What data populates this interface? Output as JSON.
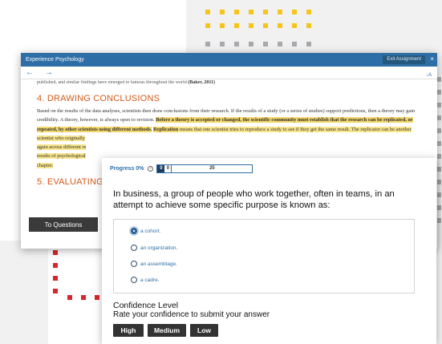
{
  "window": {
    "title": "Experience Psychology",
    "exit_label": "Exit Assignment",
    "close_glyph": "×",
    "back_glyph": "←",
    "forward_glyph": "→",
    "a11y_label": "↓A"
  },
  "reading": {
    "cut_line_start": "published, and similar findings have emerged to famous throughout the world ",
    "cut_line_cite": "(Baker, 2011)",
    "section4_title": "4. DRAWING CONCLUSIONS",
    "p1": "Based on the results of the data analyses, scientists then draw conclusions from their research. If the results of a study (or a series of studies) support predictions, then a theory may gain credibility. A theory, however, is always open to revision. ",
    "p1_hl_bold": "Before a theory is accepted or changed, the scientific community must establish that the research can be replicated, or repeated, by other scientists using different methods.",
    "p1_hl_term": "Replication",
    "p1_hl_rest": " means that one scientist tries to reproduce a study to see if they get the same result. The replicator can be another scientist who originally",
    "p2a": "again across different re",
    "p2b": "results of psychological",
    "p2c": "chapter.",
    "section5_title": "5. EVALUATING"
  },
  "to_questions_label": "To Questions",
  "panel": {
    "progress_label": "Progress 0%",
    "info_glyph": "i",
    "progress_current": "0",
    "progress_zero": "0",
    "progress_total": "25",
    "question": "In business, a group of people who work together, often in teams, in an attempt to achieve some specific purpose is known as:",
    "answers": [
      "a cohort.",
      "an organization.",
      "an assemblage.",
      "a cadre."
    ],
    "selected_answer_index": 0,
    "confidence_title": "Confidence Level",
    "confidence_sub": "Rate your confidence to submit your answer",
    "buttons": {
      "high": "High",
      "medium": "Medium",
      "low": "Low"
    }
  },
  "colors": {
    "brand_blue": "#2e6ea6",
    "heading_orange": "#d25a1b",
    "highlight_yellow": "#f8e58c",
    "dark_button": "#333333",
    "dot_yellow": "#f6c51a",
    "dot_gray": "#a7a9ac",
    "dot_red": "#d7262c"
  }
}
